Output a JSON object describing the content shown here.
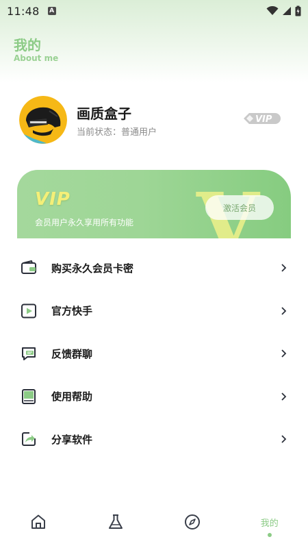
{
  "status_bar": {
    "time": "11:48",
    "notification_letter": "A"
  },
  "header": {
    "title": "我的",
    "subtitle": "About me"
  },
  "profile": {
    "name": "画质盒子",
    "status_text": "当前状态：普通用户",
    "badge": "VIP"
  },
  "vip_card": {
    "title": "VIP",
    "watermark": "V",
    "description": "会员用户永久享用所有功能",
    "button_label": "激活会员"
  },
  "menu": [
    {
      "label": "购买永久会员卡密",
      "icon": "wallet-icon"
    },
    {
      "label": "官方快手",
      "icon": "play-icon"
    },
    {
      "label": "反馈群聊",
      "icon": "chat-icon"
    },
    {
      "label": "使用帮助",
      "icon": "book-icon"
    },
    {
      "label": "分享软件",
      "icon": "share-icon"
    }
  ],
  "tab_bar": {
    "tabs": [
      {
        "icon": "home-icon",
        "label": ""
      },
      {
        "icon": "flask-icon",
        "label": ""
      },
      {
        "icon": "compass-icon",
        "label": ""
      },
      {
        "icon": "",
        "label": "我的"
      }
    ],
    "active_index": 3
  },
  "colors": {
    "accent": "#8ccb86",
    "vip_card": "#9ed696",
    "vip_title": "#f4ef78",
    "watermark": "#eaf08a"
  }
}
